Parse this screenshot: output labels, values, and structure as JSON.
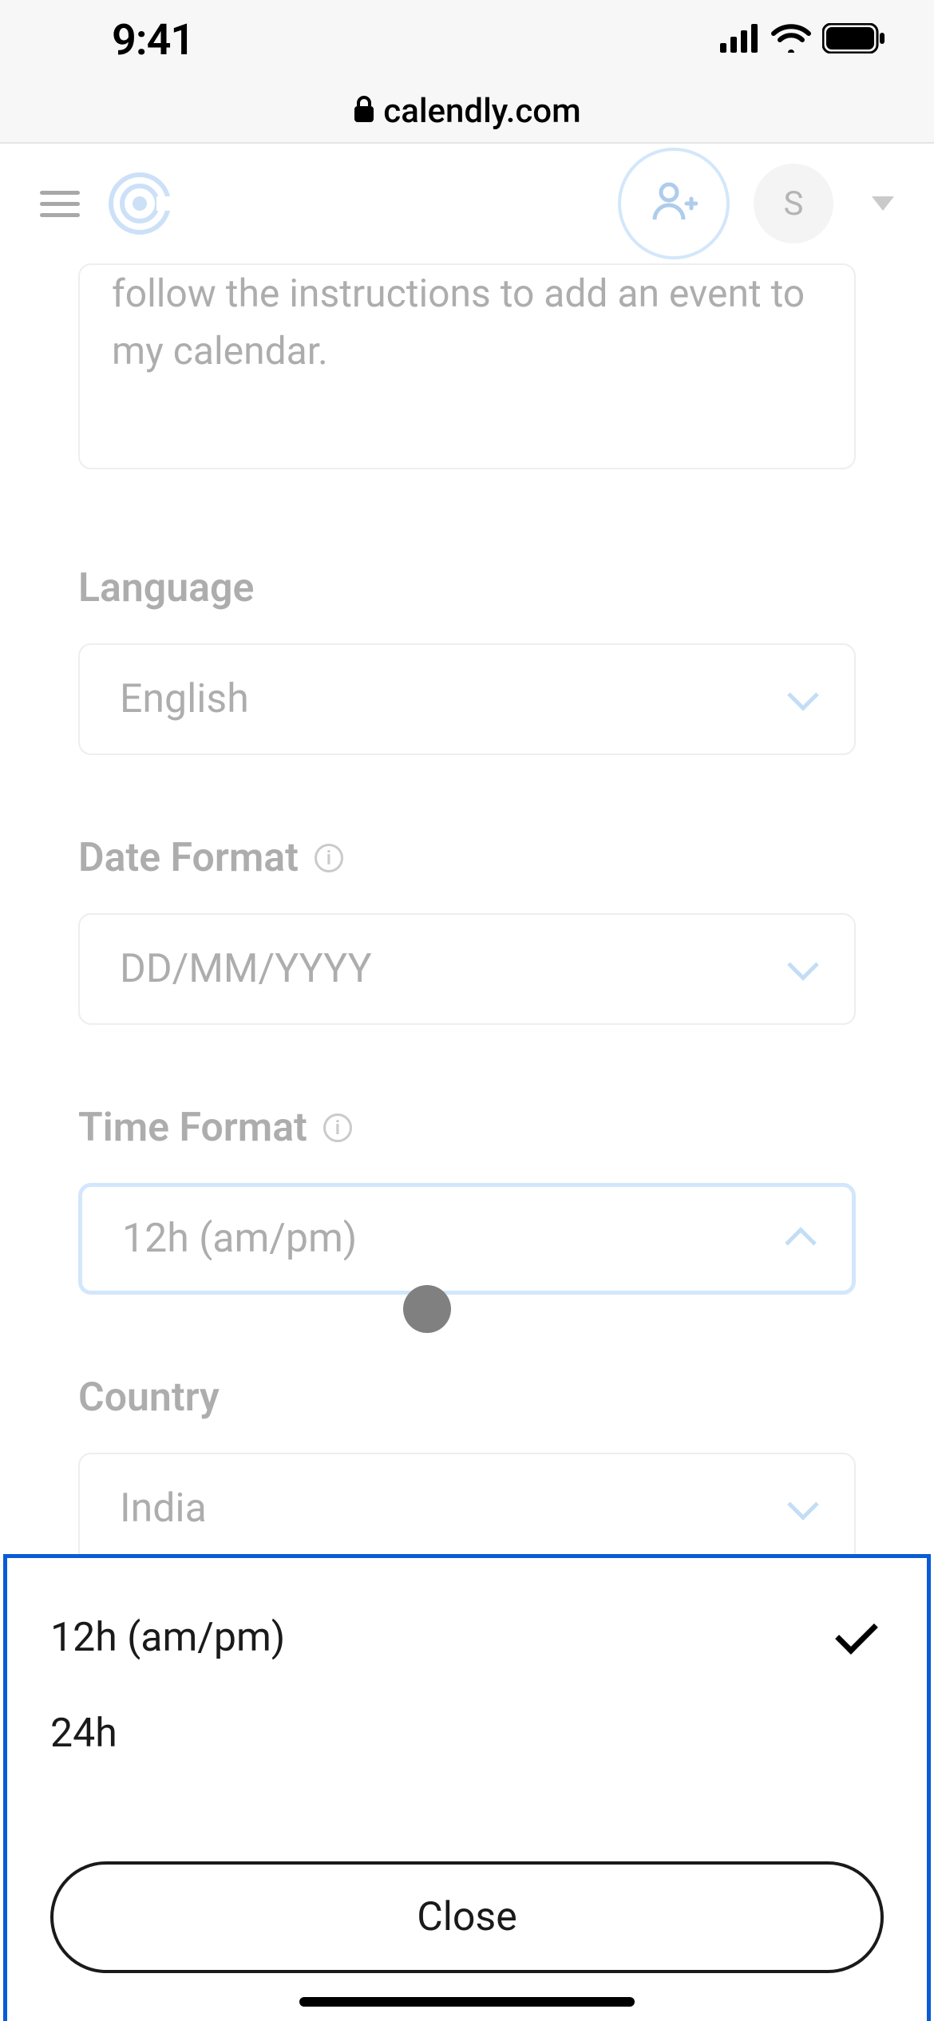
{
  "status": {
    "time": "9:41"
  },
  "url": {
    "host": "calendly.com"
  },
  "header": {
    "avatar_initial": "S"
  },
  "preview": {
    "text_fragment": "follow the instructions to add an event to my calendar."
  },
  "fields": {
    "language": {
      "label": "Language",
      "value": "English"
    },
    "date_format": {
      "label": "Date Format",
      "value": "DD/MM/YYYY"
    },
    "time_format": {
      "label": "Time Format",
      "value": "12h (am/pm)"
    },
    "country": {
      "label": "Country",
      "value": "India"
    }
  },
  "sheet": {
    "options": {
      "o0": "12h (am/pm)",
      "o1": "24h"
    },
    "close_label": "Close"
  }
}
